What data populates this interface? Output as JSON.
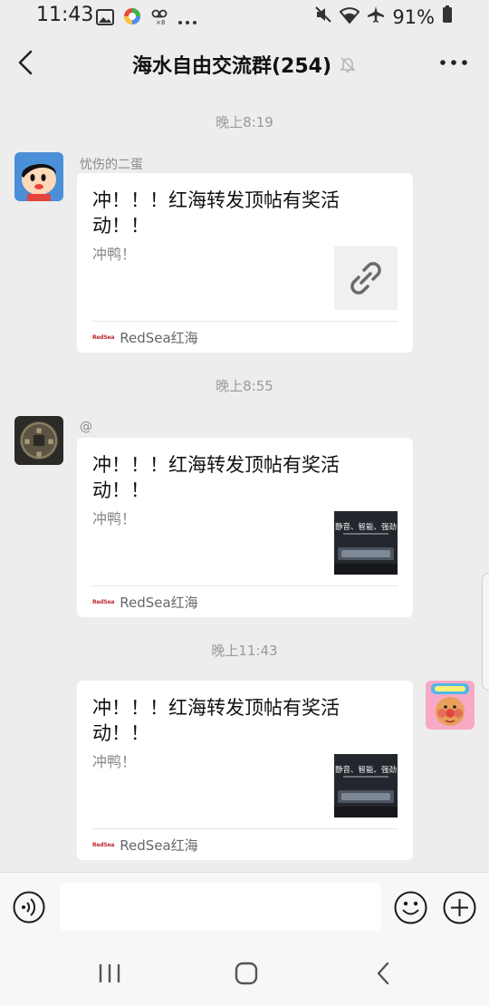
{
  "status_bar": {
    "time": "11:43",
    "battery": "91%",
    "left_icons": [
      "image-icon",
      "app-icon",
      "voicemail-icon",
      "more-dots-icon"
    ],
    "right_icons": [
      "mute-icon",
      "wifi-icon",
      "airplane-icon",
      "battery-icon"
    ]
  },
  "header": {
    "title": "海水自由交流群(254)",
    "mute_icon": "bell-off-icon"
  },
  "messages": [
    {
      "timestamp": "晚上8:19",
      "sender": "忧伤的二蛋",
      "title": "冲！！！红海转发顶帖有奖活动！！",
      "desc": "冲鸭！",
      "source": "RedSea红海",
      "thumb": "link-icon"
    },
    {
      "timestamp": "晚上8:55",
      "sender": "@",
      "title": "冲！！！红海转发顶帖有奖活动！！",
      "desc": "冲鸭！",
      "source": "RedSea红海",
      "thumb": "product-image"
    },
    {
      "timestamp": "晚上11:43",
      "sender": "",
      "title": "冲！！！红海转发顶帖有奖活动！！",
      "desc": "冲鸭！",
      "source": "RedSea红海",
      "thumb": "product-image"
    }
  ],
  "thumb_text": "静音、智能、强劲",
  "logo_text": "RedSea",
  "input": {
    "value": "",
    "placeholder": ""
  },
  "colors": {
    "background": "#ededed",
    "card": "#ffffff",
    "accent_red": "#c0262d"
  }
}
